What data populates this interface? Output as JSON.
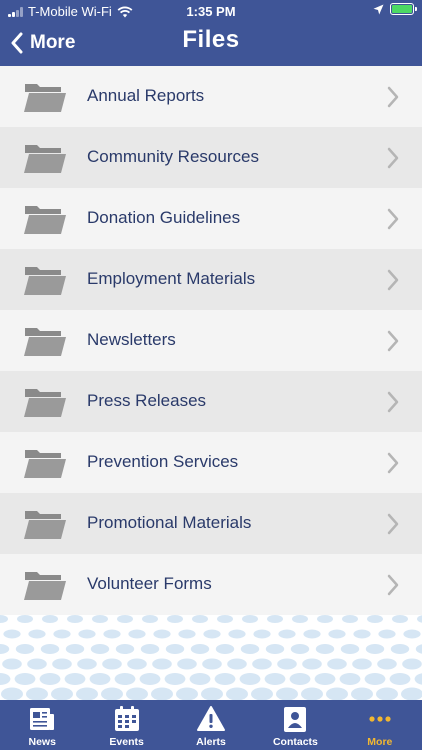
{
  "status_bar": {
    "carrier": "T-Mobile Wi-Fi",
    "time": "1:35 PM"
  },
  "nav": {
    "back_label": "More",
    "title": "Files"
  },
  "folders": [
    {
      "label": "Annual Reports"
    },
    {
      "label": "Community Resources"
    },
    {
      "label": "Donation Guidelines"
    },
    {
      "label": "Employment Materials"
    },
    {
      "label": "Newsletters"
    },
    {
      "label": "Press Releases"
    },
    {
      "label": "Prevention Services"
    },
    {
      "label": "Promotional Materials"
    },
    {
      "label": "Volunteer Forms"
    }
  ],
  "tabbar": {
    "tabs": [
      {
        "label": "News",
        "icon": "newspaper-icon"
      },
      {
        "label": "Events",
        "icon": "calendar-icon"
      },
      {
        "label": "Alerts",
        "icon": "warning-icon"
      },
      {
        "label": "Contacts",
        "icon": "contact-card-icon"
      },
      {
        "label": "More",
        "icon": "more-dots-icon"
      }
    ],
    "active_tab": "More"
  },
  "colors": {
    "brand": "#3f5597",
    "active_tab": "#f2b731",
    "row_label": "#2a3a6a",
    "folder": "#8a8a8a",
    "battery": "#4cd964"
  }
}
